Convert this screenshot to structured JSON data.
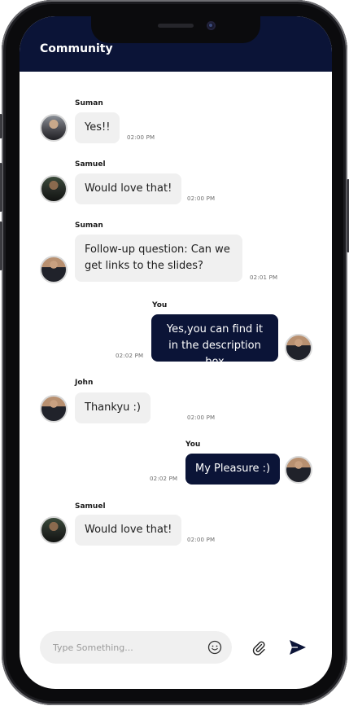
{
  "header": {
    "title": "Community"
  },
  "messages": [
    {
      "sender": "Suman",
      "text": "Yes!!",
      "time": "02:00 PM",
      "mine": false
    },
    {
      "sender": "Samuel",
      "text": "Would love that!",
      "time": "02:00 PM",
      "mine": false
    },
    {
      "sender": "Suman",
      "text": "Follow-up question: Can we get links to the slides?",
      "time": "02:01 PM",
      "mine": false
    },
    {
      "sender": "You",
      "text": "Yes,you can find it in the description box",
      "time": "02:02 PM",
      "mine": true
    },
    {
      "sender": "John",
      "text": "Thankyu :)",
      "time": "02:00 PM",
      "mine": false
    },
    {
      "sender": "You",
      "text": "My Pleasure :)",
      "time": "02:02 PM",
      "mine": true
    },
    {
      "sender": "Samuel",
      "text": "Would love that!",
      "time": "02:00 PM",
      "mine": false
    }
  ],
  "composer": {
    "placeholder": "Type Something...",
    "emoji_icon": "smiley-icon",
    "attach_icon": "paperclip-icon",
    "send_icon": "send-icon"
  },
  "colors": {
    "accent": "#0b1437",
    "bubble_in": "#f0f0f0",
    "bubble_out": "#0b1437"
  }
}
